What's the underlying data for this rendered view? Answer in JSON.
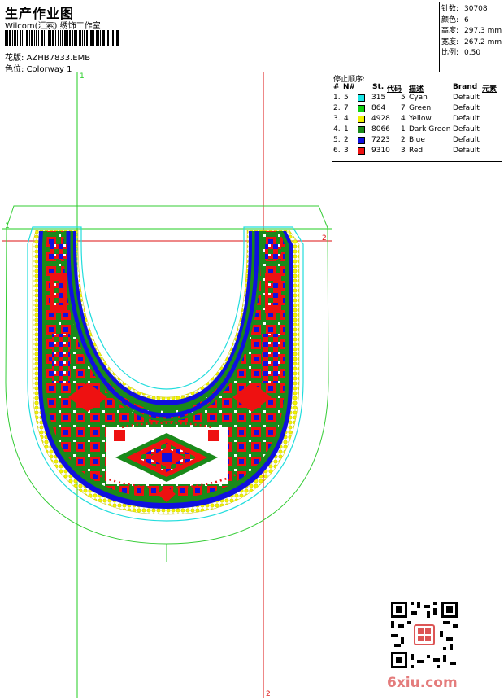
{
  "header": {
    "title": "生产作业图",
    "subtitle": "Wilcom(汇索) 绣饰工作室",
    "design_label": "花版:",
    "design_value": "AZHB7833.EMB",
    "colorway_label": "色位:",
    "colorway_value": "Colorway 1"
  },
  "stats": [
    {
      "label": "针数:",
      "value": "30708"
    },
    {
      "label": "颜色:",
      "value": "6"
    },
    {
      "label": "高度:",
      "value": "297.3 mm"
    },
    {
      "label": "宽度:",
      "value": "267.2 mm"
    },
    {
      "label": "比例:",
      "value": "0.50"
    }
  ],
  "legend": {
    "title": "停止顺序:",
    "headers": {
      "num": "#",
      "no": "N#",
      "st": "St.",
      "code": "代码",
      "desc": "描述",
      "brand": "Brand",
      "elem": "元素"
    },
    "rows": [
      {
        "num": "1.",
        "no": "5",
        "st": "315",
        "code": "5",
        "desc": "Cyan",
        "brand": "Default",
        "color": "#19e6e6"
      },
      {
        "num": "2.",
        "no": "7",
        "st": "864",
        "code": "7",
        "desc": "Green",
        "brand": "Default",
        "color": "#10d010"
      },
      {
        "num": "3.",
        "no": "4",
        "st": "4928",
        "code": "4",
        "desc": "Yellow",
        "brand": "Default",
        "color": "#f0f000"
      },
      {
        "num": "4.",
        "no": "1",
        "st": "8066",
        "code": "1",
        "desc": "Dark Green",
        "brand": "Default",
        "color": "#1a8a1a"
      },
      {
        "num": "5.",
        "no": "2",
        "st": "7223",
        "code": "2",
        "desc": "Blue",
        "brand": "Default",
        "color": "#1010e0"
      },
      {
        "num": "6.",
        "no": "3",
        "st": "9310",
        "code": "3",
        "desc": "Red",
        "brand": "Default",
        "color": "#ee1111"
      }
    ]
  },
  "guides": {
    "v1": "1",
    "v2": "2",
    "h1": "1",
    "h2": "2"
  },
  "watermark": {
    "prefix": "6",
    "rest": "xiu.com"
  },
  "colors": {
    "guide_green": "#22cc22",
    "guide_red": "#dd1111",
    "outline_green": "#33cc33",
    "outline_cyan": "#22dddd"
  }
}
